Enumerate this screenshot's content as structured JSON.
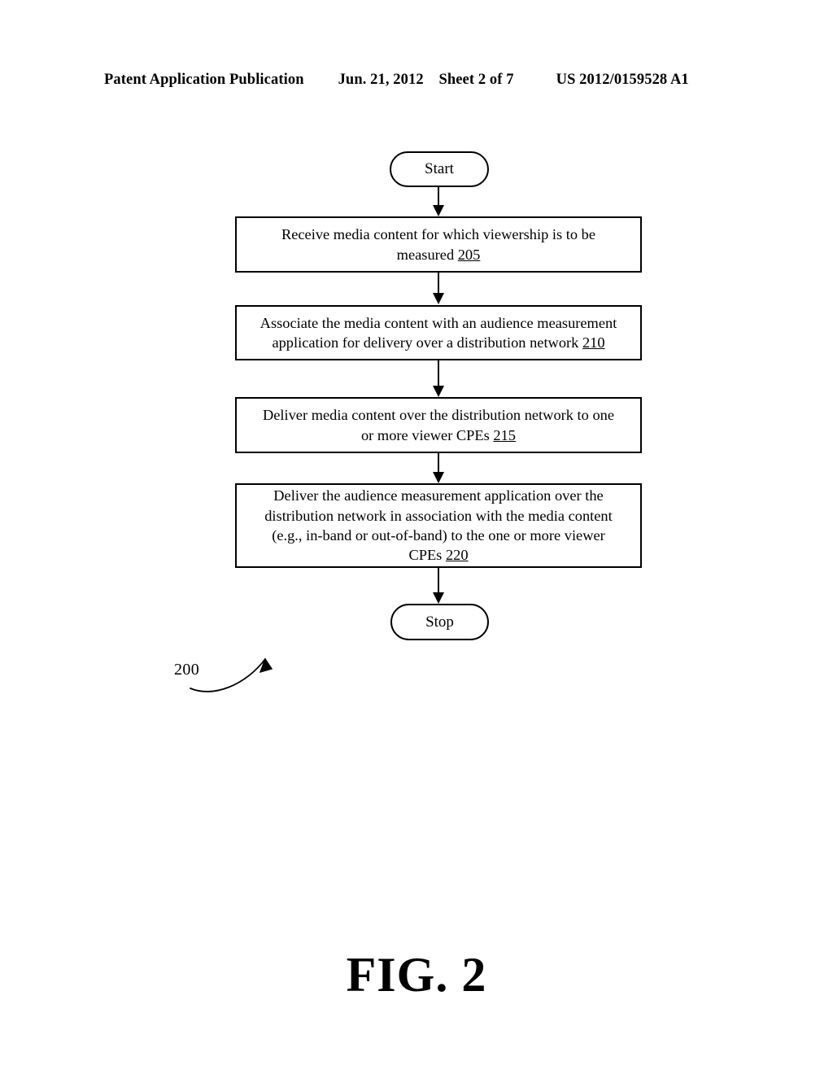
{
  "page": {
    "background_color": "#ffffff",
    "ink_color": "#000000"
  },
  "header": {
    "left": "Patent Application Publication",
    "date": "Jun. 21, 2012",
    "sheet": "Sheet 2 of 7",
    "publication_number": "US 2012/0159528 A1"
  },
  "figure": {
    "caption": "FIG. 2",
    "reference_label": "200"
  },
  "flowchart": {
    "type": "flowchart",
    "orientation": "top-to-bottom",
    "nodes": [
      {
        "id": "start",
        "shape": "terminal",
        "label": "Start"
      },
      {
        "id": "step-205",
        "shape": "process",
        "ref": "205",
        "lines": [
          "Receive media content for which viewership is to be",
          "measured "
        ]
      },
      {
        "id": "step-210",
        "shape": "process",
        "ref": "210",
        "lines": [
          "Associate the media content with an audience measurement",
          "application for delivery over a distribution network "
        ]
      },
      {
        "id": "step-215",
        "shape": "process",
        "ref": "215",
        "lines": [
          "Deliver media content over the distribution network to one",
          "or more viewer CPEs "
        ]
      },
      {
        "id": "step-220",
        "shape": "process",
        "ref": "220",
        "lines": [
          "Deliver the audience measurement application over the",
          "distribution network in association with the media content",
          "(e.g., in-band or out-of-band) to the one or more viewer",
          "CPEs "
        ]
      },
      {
        "id": "stop",
        "shape": "terminal",
        "label": "Stop"
      }
    ],
    "edges": [
      {
        "from": "start",
        "to": "step-205",
        "style": "arrow"
      },
      {
        "from": "step-205",
        "to": "step-210",
        "style": "arrow"
      },
      {
        "from": "step-210",
        "to": "step-215",
        "style": "arrow"
      },
      {
        "from": "step-215",
        "to": "step-220",
        "style": "arrow"
      },
      {
        "from": "step-220",
        "to": "stop",
        "style": "arrow"
      }
    ]
  }
}
